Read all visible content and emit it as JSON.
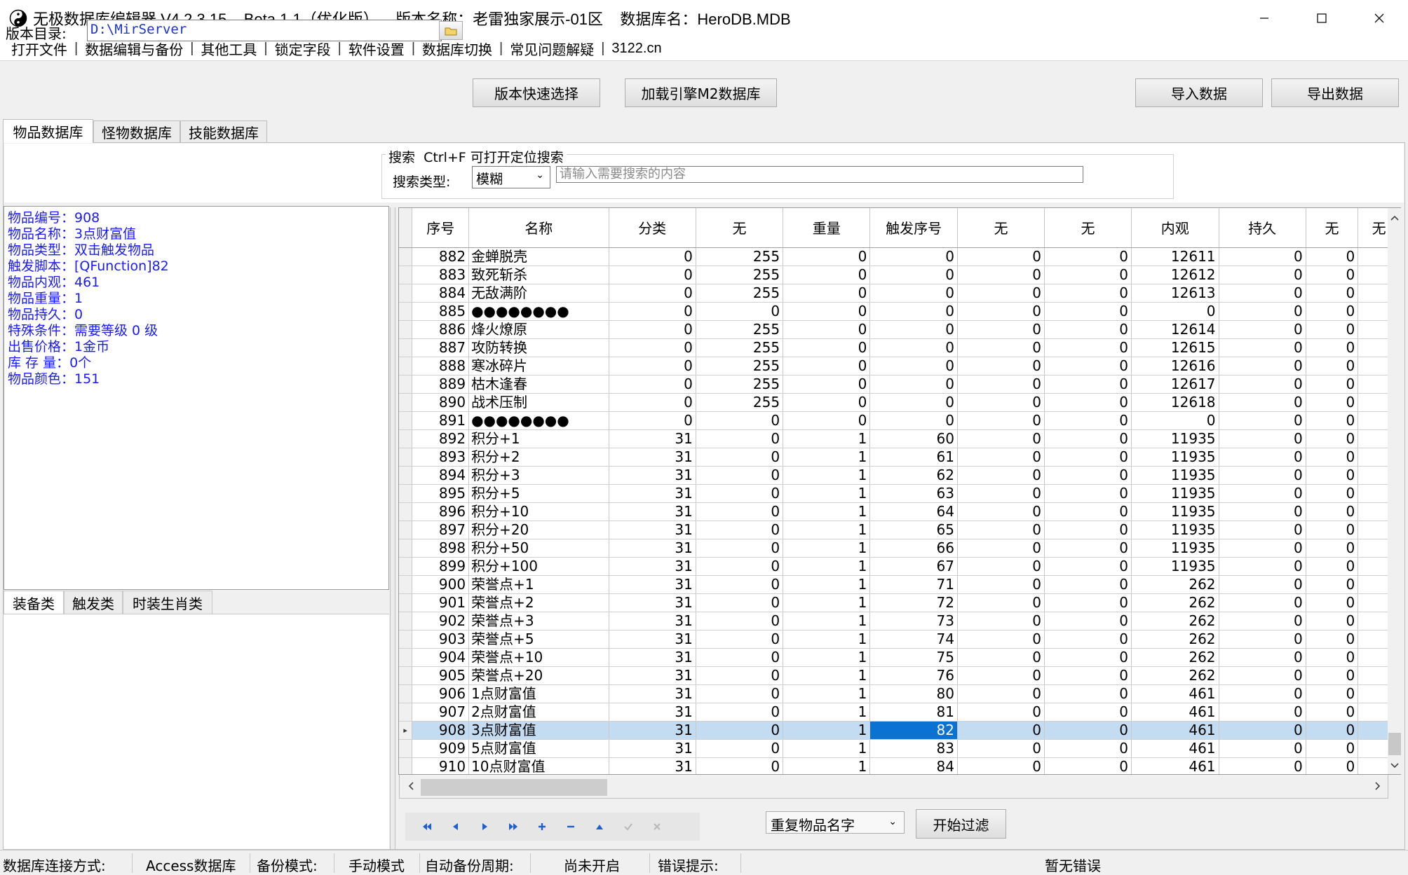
{
  "titlebar": {
    "title": "无极数据库编辑器 V4.2.3.15    Beta 1.1（优化版）    版本名称：老雷独家展示-01区    数据库名：HeroDB.MDB"
  },
  "menu": [
    "打开文件",
    "数据编辑与备份",
    "其他工具",
    "锁定字段",
    "软件设置",
    "数据库切换",
    "常见问题解疑",
    "3122.cn"
  ],
  "toolbar": {
    "dir_label": "版本目录:",
    "dir_value": "D:\\MirServer",
    "quick_select": "版本快速选择",
    "load_m2": "加载引擎M2数据库",
    "import": "导入数据",
    "export": "导出数据"
  },
  "tabs": [
    "物品数据库",
    "怪物数据库",
    "技能数据库"
  ],
  "search": {
    "legend": "搜索  Ctrl+F 可打开定位搜索",
    "type_label": "搜索类型:",
    "type_value": "模糊",
    "placeholder": "请输入需要搜索的内容"
  },
  "info": [
    "物品编号：908",
    "物品名称：3点财富值",
    "物品类型：双击触发物品",
    "触发脚本：[QFunction]82",
    "物品内观：461",
    "物品重量：1",
    "物品持久：0",
    "特殊条件：需要等级 0 级",
    "出售价格：1金币",
    "库 存 量：0个",
    "物品颜色：151"
  ],
  "subtabs": [
    "装备类",
    "触发类",
    "时装生肖类"
  ],
  "grid": {
    "headers": [
      "序号",
      "名称",
      "分类",
      "无",
      "重量",
      "触发序号",
      "无",
      "无",
      "内观",
      "持久",
      "无",
      "无"
    ],
    "rows": [
      [
        "882",
        "金蝉脱壳",
        "0",
        "255",
        "0",
        "0",
        "0",
        "0",
        "12611",
        "0",
        "0"
      ],
      [
        "883",
        "致死斩杀",
        "0",
        "255",
        "0",
        "0",
        "0",
        "0",
        "12612",
        "0",
        "0"
      ],
      [
        "884",
        "无敌满阶",
        "0",
        "255",
        "0",
        "0",
        "0",
        "0",
        "12613",
        "0",
        "0"
      ],
      [
        "885",
        "●●●●●●●●",
        "0",
        "0",
        "0",
        "0",
        "0",
        "0",
        "0",
        "0",
        "0"
      ],
      [
        "886",
        "烽火燎原",
        "0",
        "255",
        "0",
        "0",
        "0",
        "0",
        "12614",
        "0",
        "0"
      ],
      [
        "887",
        "攻防转换",
        "0",
        "255",
        "0",
        "0",
        "0",
        "0",
        "12615",
        "0",
        "0"
      ],
      [
        "888",
        "寒冰碎片",
        "0",
        "255",
        "0",
        "0",
        "0",
        "0",
        "12616",
        "0",
        "0"
      ],
      [
        "889",
        "枯木逢春",
        "0",
        "255",
        "0",
        "0",
        "0",
        "0",
        "12617",
        "0",
        "0"
      ],
      [
        "890",
        "战术压制",
        "0",
        "255",
        "0",
        "0",
        "0",
        "0",
        "12618",
        "0",
        "0"
      ],
      [
        "891",
        "●●●●●●●●",
        "0",
        "0",
        "0",
        "0",
        "0",
        "0",
        "0",
        "0",
        "0"
      ],
      [
        "892",
        "积分+1",
        "31",
        "0",
        "1",
        "60",
        "0",
        "0",
        "11935",
        "0",
        "0"
      ],
      [
        "893",
        "积分+2",
        "31",
        "0",
        "1",
        "61",
        "0",
        "0",
        "11935",
        "0",
        "0"
      ],
      [
        "894",
        "积分+3",
        "31",
        "0",
        "1",
        "62",
        "0",
        "0",
        "11935",
        "0",
        "0"
      ],
      [
        "895",
        "积分+5",
        "31",
        "0",
        "1",
        "63",
        "0",
        "0",
        "11935",
        "0",
        "0"
      ],
      [
        "896",
        "积分+10",
        "31",
        "0",
        "1",
        "64",
        "0",
        "0",
        "11935",
        "0",
        "0"
      ],
      [
        "897",
        "积分+20",
        "31",
        "0",
        "1",
        "65",
        "0",
        "0",
        "11935",
        "0",
        "0"
      ],
      [
        "898",
        "积分+50",
        "31",
        "0",
        "1",
        "66",
        "0",
        "0",
        "11935",
        "0",
        "0"
      ],
      [
        "899",
        "积分+100",
        "31",
        "0",
        "1",
        "67",
        "0",
        "0",
        "11935",
        "0",
        "0"
      ],
      [
        "900",
        "荣誉点+1",
        "31",
        "0",
        "1",
        "71",
        "0",
        "0",
        "262",
        "0",
        "0"
      ],
      [
        "901",
        "荣誉点+2",
        "31",
        "0",
        "1",
        "72",
        "0",
        "0",
        "262",
        "0",
        "0"
      ],
      [
        "902",
        "荣誉点+3",
        "31",
        "0",
        "1",
        "73",
        "0",
        "0",
        "262",
        "0",
        "0"
      ],
      [
        "903",
        "荣誉点+5",
        "31",
        "0",
        "1",
        "74",
        "0",
        "0",
        "262",
        "0",
        "0"
      ],
      [
        "904",
        "荣誉点+10",
        "31",
        "0",
        "1",
        "75",
        "0",
        "0",
        "262",
        "0",
        "0"
      ],
      [
        "905",
        "荣誉点+20",
        "31",
        "0",
        "1",
        "76",
        "0",
        "0",
        "262",
        "0",
        "0"
      ],
      [
        "906",
        "1点财富值",
        "31",
        "0",
        "1",
        "80",
        "0",
        "0",
        "461",
        "0",
        "0"
      ],
      [
        "907",
        "2点财富值",
        "31",
        "0",
        "1",
        "81",
        "0",
        "0",
        "461",
        "0",
        "0"
      ],
      [
        "908",
        "3点财富值",
        "31",
        "0",
        "1",
        "82",
        "0",
        "0",
        "461",
        "0",
        "0"
      ],
      [
        "909",
        "5点财富值",
        "31",
        "0",
        "1",
        "83",
        "0",
        "0",
        "461",
        "0",
        "0"
      ],
      [
        "910",
        "10点财富值",
        "31",
        "0",
        "1",
        "84",
        "0",
        "0",
        "461",
        "0",
        "0"
      ]
    ],
    "selected_id": "908",
    "selection_color": "#c4dcf2",
    "current_cell_color": "#0a72d2"
  },
  "navigator": [
    "first-icon",
    "prior-icon",
    "next-icon",
    "last-icon",
    "insert-icon",
    "delete-icon",
    "edit-icon",
    "post-icon",
    "cancel-icon"
  ],
  "filter": {
    "value": "重复物品名字",
    "button": "开始过滤"
  },
  "status": {
    "conn_label": "数据库连接方式:",
    "conn_value": "Access数据库",
    "backup_label": "备份模式:",
    "backup_value": "手动模式",
    "auto_label": "自动备份周期:",
    "auto_value": "尚未开启",
    "error_label": "错误提示:",
    "error_value": "暂无错误"
  }
}
